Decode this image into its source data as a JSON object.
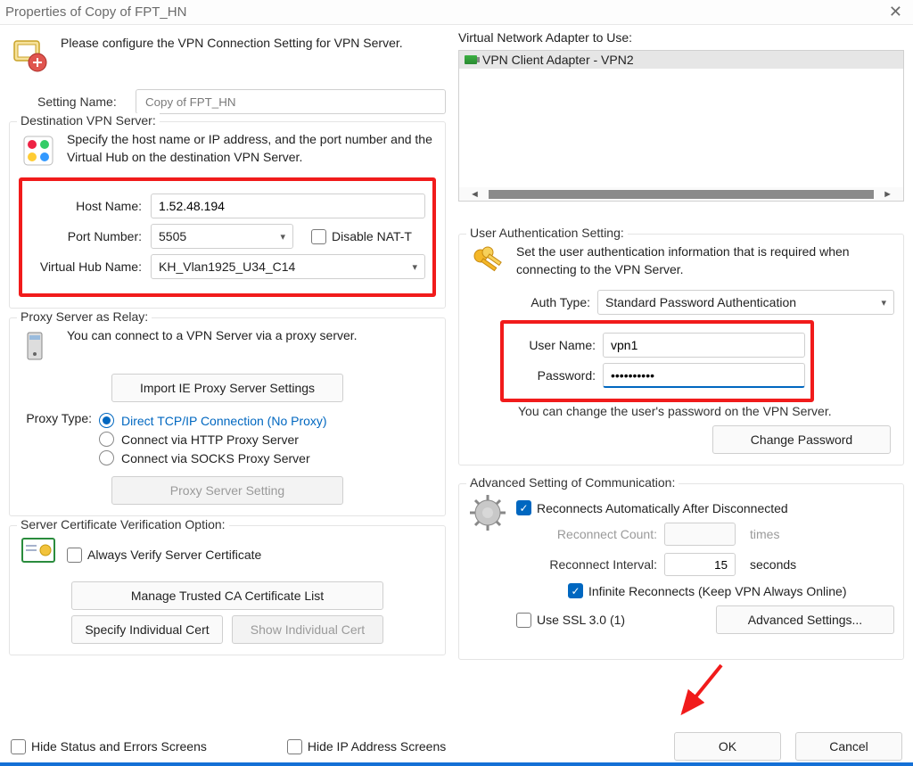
{
  "window": {
    "title": "Properties of Copy of FPT_HN"
  },
  "left": {
    "intro": "Please configure the VPN Connection Setting for VPN Server.",
    "setting_name_label": "Setting Name:",
    "setting_name_value": "Copy of FPT_HN",
    "dest_group_title": "Destination VPN Server:",
    "dest_caption": "Specify the host name or IP address, and the port number and the Virtual Hub on the destination VPN Server.",
    "host_name_label": "Host Name:",
    "host_name_value": "1.52.48.194",
    "port_label": "Port Number:",
    "port_value": "5505",
    "disable_natt_label": "Disable NAT-T",
    "hub_label": "Virtual Hub Name:",
    "hub_value": "KH_Vlan1925_U34_C14",
    "proxy_group_title": "Proxy Server as Relay:",
    "proxy_caption": "You can connect to a VPN Server via a proxy server.",
    "import_ie_btn": "Import IE Proxy Server Settings",
    "proxy_type_label": "Proxy Type:",
    "proxy_opts": {
      "direct": "Direct TCP/IP Connection (No Proxy)",
      "http": "Connect via HTTP Proxy Server",
      "socks": "Connect via SOCKS Proxy Server"
    },
    "proxy_setting_btn": "Proxy Server Setting",
    "cert_group_title": "Server Certificate Verification Option:",
    "always_verify_label": "Always Verify Server Certificate",
    "manage_ca_btn": "Manage Trusted CA Certificate List",
    "spec_cert_btn": "Specify Individual Cert",
    "show_cert_btn": "Show Individual Cert"
  },
  "right": {
    "adapter_title": "Virtual Network Adapter to Use:",
    "adapter_selected": "VPN Client Adapter - VPN2",
    "auth_group_title": "User Authentication Setting:",
    "auth_caption": "Set the user authentication information that is required when connecting to the VPN Server.",
    "auth_type_label": "Auth Type:",
    "auth_type_value": "Standard Password Authentication",
    "user_label": "User Name:",
    "user_value": "vpn1",
    "pass_label": "Password:",
    "pass_value": "••••••••••",
    "change_pw_note": "You can change the user's password on the VPN Server.",
    "change_pw_btn": "Change Password",
    "adv_group_title": "Advanced Setting of Communication:",
    "auto_reconnect_label": "Reconnects Automatically After Disconnected",
    "reconnect_count_label": "Reconnect Count:",
    "reconnect_count_value": "",
    "reconnect_count_unit": "times",
    "reconnect_interval_label": "Reconnect Interval:",
    "reconnect_interval_value": "15",
    "reconnect_interval_unit": "seconds",
    "infinite_label": "Infinite Reconnects (Keep VPN Always Online)",
    "use_ssl_label": "Use SSL 3.0 (1)",
    "adv_settings_btn": "Advanced Settings..."
  },
  "bottom": {
    "hide_status_label": "Hide Status and Errors Screens",
    "hide_ip_label": "Hide IP Address Screens",
    "ok": "OK",
    "cancel": "Cancel"
  }
}
